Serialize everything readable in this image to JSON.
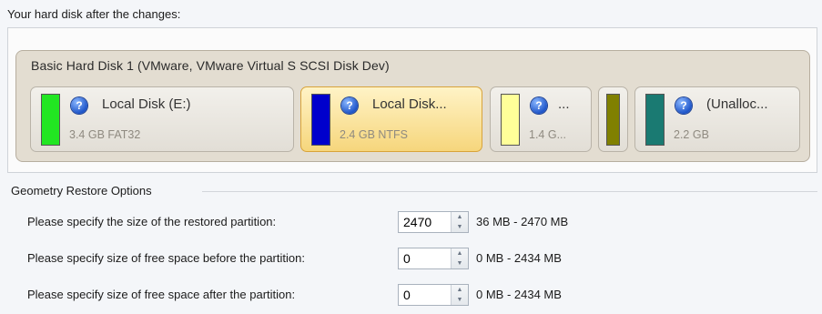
{
  "header": {
    "label": "Your hard disk after the changes:"
  },
  "disk": {
    "title": "Basic Hard Disk 1 (VMware, VMware Virtual S SCSI Disk Dev)",
    "partitions": [
      {
        "name": "Local Disk (E:)",
        "info": "3.4 GB FAT32",
        "color": "#22e622",
        "selected": false
      },
      {
        "name": "Local Disk...",
        "info": "2.4 GB NTFS",
        "color": "#0000cc",
        "selected": true
      },
      {
        "name": "...",
        "info": "1.4 G...",
        "color": "#ffff99",
        "selected": false
      },
      {
        "name": "",
        "info": "",
        "color": "#808000",
        "selected": false
      },
      {
        "name": "(Unalloc...",
        "info": "2.2 GB",
        "color": "#1a7a72",
        "selected": false
      }
    ]
  },
  "geometry": {
    "title": "Geometry Restore Options",
    "rows": [
      {
        "label": "Please specify the size of the restored partition:",
        "value": "2470",
        "range": "36 MB - 2470 MB"
      },
      {
        "label": "Please specify size of free space before the partition:",
        "value": "0",
        "range": "0 MB - 2434 MB"
      },
      {
        "label": "Please specify size of free space after the partition:",
        "value": "0",
        "range": "0 MB - 2434 MB"
      }
    ]
  },
  "icons": {
    "help": "question-icon",
    "spin_up": "arrow-up-icon",
    "spin_down": "arrow-down-icon"
  }
}
